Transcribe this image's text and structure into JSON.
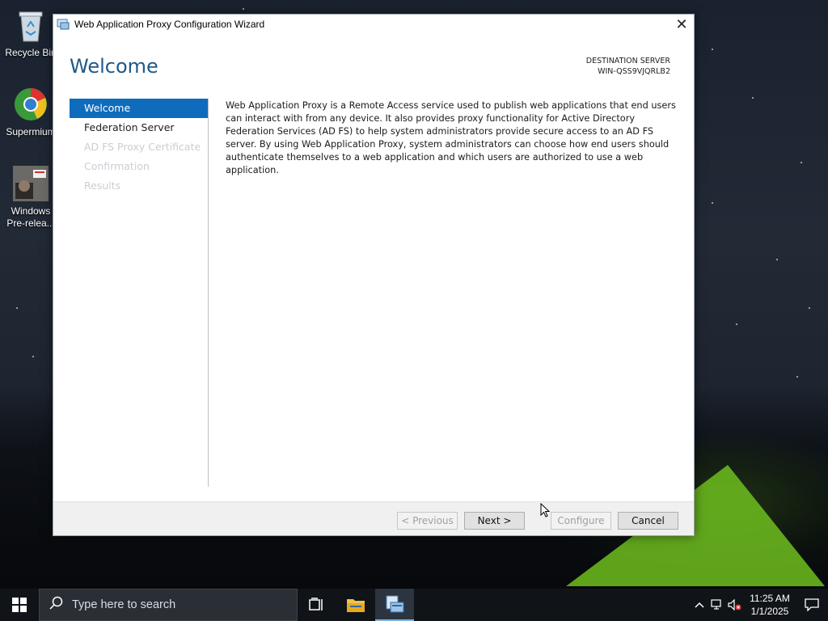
{
  "desktop": {
    "icons": [
      {
        "label": "Recycle Bin",
        "icon": "recycle-bin-icon"
      },
      {
        "label": "Supermium",
        "icon": "supermium-browser-icon"
      },
      {
        "label": "Windows Pre-relea...",
        "icon": "windows-prerelease-icon"
      }
    ]
  },
  "window": {
    "title": "Web Application Proxy Configuration Wizard",
    "heading": "Welcome",
    "destination_label": "DESTINATION SERVER",
    "destination_server": "WIN-QSS9VJQRLB2",
    "nav": [
      {
        "label": "Welcome",
        "state": "active"
      },
      {
        "label": "Federation Server",
        "state": "enabled"
      },
      {
        "label": "AD FS Proxy Certificate",
        "state": "disabled"
      },
      {
        "label": "Confirmation",
        "state": "disabled"
      },
      {
        "label": "Results",
        "state": "disabled"
      }
    ],
    "body_text": "Web Application Proxy is a Remote Access service used to publish web applications that end users can interact with from any device. It also provides proxy functionality for Active Directory Federation Services (AD FS) to help system administrators provide secure access to an AD FS server. By using Web Application Proxy, system administrators can choose how end users should authenticate themselves to a web application and which users are authorized to use a web application.",
    "buttons": {
      "previous": "< Previous",
      "next": "Next >",
      "configure": "Configure",
      "cancel": "Cancel"
    }
  },
  "taskbar": {
    "search_placeholder": "Type here to search",
    "time": "11:25 AM",
    "date": "1/1/2025"
  },
  "colors": {
    "accent": "#0f6cbd",
    "heading": "#1e5a8a"
  }
}
